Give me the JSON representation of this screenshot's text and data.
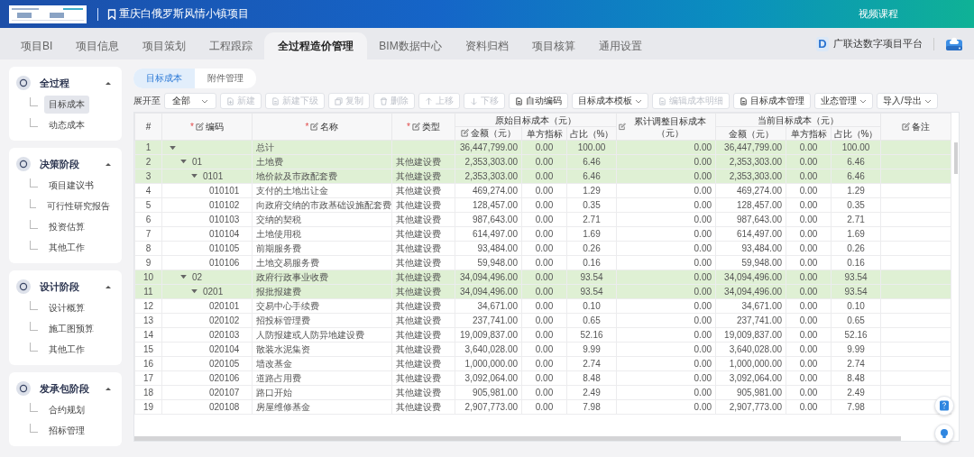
{
  "header": {
    "project_title": "重庆白俄罗斯风情小镇项目",
    "video_course": "视频课程"
  },
  "nav_tabs": [
    {
      "label": "项目BI",
      "selected": false
    },
    {
      "label": "项目信息",
      "selected": false
    },
    {
      "label": "项目策划",
      "selected": false
    },
    {
      "label": "工程跟踪",
      "selected": false
    },
    {
      "label": "全过程造价管理",
      "selected": true
    },
    {
      "label": "BIM数据中心",
      "selected": false
    },
    {
      "label": "资料归档",
      "selected": false
    },
    {
      "label": "项目核算",
      "selected": false
    },
    {
      "label": "通用设置",
      "selected": false
    }
  ],
  "platform": {
    "logo_letter": "D",
    "name": "广联达数字项目平台"
  },
  "sidebar": {
    "groups": [
      {
        "title": "全过程",
        "expanded": true,
        "items": [
          {
            "label": "目标成本",
            "selected": true
          },
          {
            "label": "动态成本",
            "selected": false
          }
        ]
      },
      {
        "title": "决策阶段",
        "expanded": true,
        "items": [
          {
            "label": "项目建议书",
            "selected": false
          },
          {
            "label": "可行性研究报告",
            "selected": false
          },
          {
            "label": "投资估算",
            "selected": false
          },
          {
            "label": "其他工作",
            "selected": false
          }
        ]
      },
      {
        "title": "设计阶段",
        "expanded": true,
        "items": [
          {
            "label": "设计概算",
            "selected": false
          },
          {
            "label": "施工图预算",
            "selected": false
          },
          {
            "label": "其他工作",
            "selected": false
          }
        ]
      },
      {
        "title": "发承包阶段",
        "expanded": true,
        "items": [
          {
            "label": "合约规划",
            "selected": false
          },
          {
            "label": "招标管理",
            "selected": false
          }
        ]
      }
    ]
  },
  "subtabs": [
    {
      "label": "目标成本",
      "selected": true
    },
    {
      "label": "附件管理",
      "selected": false
    }
  ],
  "toolbar": {
    "expand_label": "展开至",
    "expand_value": "全部",
    "buttons": [
      {
        "label": "新建",
        "kind": "button",
        "disabled": true
      },
      {
        "label": "新建下级",
        "kind": "button",
        "disabled": true
      },
      {
        "label": "复制",
        "kind": "button",
        "disabled": true
      },
      {
        "label": "删除",
        "kind": "button",
        "disabled": true
      },
      {
        "label": "上移",
        "kind": "button",
        "disabled": true
      },
      {
        "label": "下移",
        "kind": "button",
        "disabled": true
      },
      {
        "label": "自动编码",
        "kind": "button",
        "disabled": false
      },
      {
        "label": "目标成本模板",
        "kind": "dropdown",
        "disabled": false
      },
      {
        "label": "编辑成本明细",
        "kind": "button",
        "disabled": true
      },
      {
        "label": "目标成本管理",
        "kind": "button",
        "disabled": false
      },
      {
        "label": "业态管理",
        "kind": "dropdown",
        "disabled": false
      },
      {
        "label": "导入/导出",
        "kind": "dropdown",
        "disabled": false
      }
    ]
  },
  "table": {
    "columns": [
      {
        "label": "#"
      },
      {
        "label": "编码",
        "required": true,
        "marker": "*",
        "editable": true
      },
      {
        "label": "名称",
        "required": true,
        "marker": "*",
        "editable": true
      },
      {
        "label": "类型",
        "required": true,
        "marker": "*",
        "editable": true
      },
      {
        "label": "金额（元）",
        "editable": true
      },
      {
        "label": "单方指标"
      },
      {
        "label": "占比（%）"
      },
      {
        "label": "累计调整目标成本（元）",
        "editable": true
      },
      {
        "label": "金额（元）"
      },
      {
        "label": "单方指标"
      },
      {
        "label": "占比（%）"
      },
      {
        "label": "备注",
        "editable": true
      }
    ],
    "column_groups": [
      {
        "label": "原始目标成本（元）"
      },
      {
        "label": "当前目标成本（元）"
      }
    ],
    "rows": [
      {
        "cells": [
          "1",
          "",
          "总计",
          "",
          "36,447,799.00",
          "0.00",
          "100.00",
          "0.00",
          "36,447,799.00",
          "0.00",
          "100.00"
        ],
        "expanded": true,
        "children": [
          {
            "cells": [
              "2",
              "01",
              "土地费",
              "其他建设费",
              "2,353,303.00",
              "0.00",
              "6.46",
              "0.00",
              "2,353,303.00",
              "0.00",
              "6.46"
            ],
            "expanded": true,
            "children": [
              {
                "cells": [
                  "3",
                  "0101",
                  "地价款及市政配套费",
                  "其他建设费",
                  "2,353,303.00",
                  "0.00",
                  "6.46",
                  "0.00",
                  "2,353,303.00",
                  "0.00",
                  "6.46"
                ],
                "expanded": true,
                "children": [
                  {
                    "cells": [
                      "4",
                      "010101",
                      "支付的土地出让金",
                      "其他建设费",
                      "469,274.00",
                      "0.00",
                      "1.29",
                      "0.00",
                      "469,274.00",
                      "0.00",
                      "1.29"
                    ]
                  },
                  {
                    "cells": [
                      "5",
                      "010102",
                      "向政府交纳的市政基础设施配套费",
                      "其他建设费",
                      "128,457.00",
                      "0.00",
                      "0.35",
                      "0.00",
                      "128,457.00",
                      "0.00",
                      "0.35"
                    ]
                  },
                  {
                    "cells": [
                      "6",
                      "010103",
                      "交纳的契税",
                      "其他建设费",
                      "987,643.00",
                      "0.00",
                      "2.71",
                      "0.00",
                      "987,643.00",
                      "0.00",
                      "2.71"
                    ]
                  },
                  {
                    "cells": [
                      "7",
                      "010104",
                      "土地使用税",
                      "其他建设费",
                      "614,497.00",
                      "0.00",
                      "1.69",
                      "0.00",
                      "614,497.00",
                      "0.00",
                      "1.69"
                    ]
                  },
                  {
                    "cells": [
                      "8",
                      "010105",
                      "前期服务费",
                      "其他建设费",
                      "93,484.00",
                      "0.00",
                      "0.26",
                      "0.00",
                      "93,484.00",
                      "0.00",
                      "0.26"
                    ]
                  },
                  {
                    "cells": [
                      "9",
                      "010106",
                      "土地交易服务费",
                      "其他建设费",
                      "59,948.00",
                      "0.00",
                      "0.16",
                      "0.00",
                      "59,948.00",
                      "0.00",
                      "0.16"
                    ]
                  }
                ]
              }
            ]
          },
          {
            "cells": [
              "10",
              "02",
              "政府行政事业收费",
              "其他建设费",
              "34,094,496.00",
              "0.00",
              "93.54",
              "0.00",
              "34,094,496.00",
              "0.00",
              "93.54"
            ],
            "expanded": true,
            "children": [
              {
                "cells": [
                  "11",
                  "0201",
                  "报批报建费",
                  "其他建设费",
                  "34,094,496.00",
                  "0.00",
                  "93.54",
                  "0.00",
                  "34,094,496.00",
                  "0.00",
                  "93.54"
                ],
                "expanded": true,
                "children": [
                  {
                    "cells": [
                      "12",
                      "020101",
                      "交易中心手续费",
                      "其他建设费",
                      "34,671.00",
                      "0.00",
                      "0.10",
                      "0.00",
                      "34,671.00",
                      "0.00",
                      "0.10"
                    ]
                  },
                  {
                    "cells": [
                      "13",
                      "020102",
                      "招投标管理费",
                      "其他建设费",
                      "237,741.00",
                      "0.00",
                      "0.65",
                      "0.00",
                      "237,741.00",
                      "0.00",
                      "0.65"
                    ]
                  },
                  {
                    "cells": [
                      "14",
                      "020103",
                      "人防报建或人防异地建设费",
                      "其他建设费",
                      "19,009,837.00",
                      "0.00",
                      "52.16",
                      "0.00",
                      "19,009,837.00",
                      "0.00",
                      "52.16"
                    ]
                  },
                  {
                    "cells": [
                      "15",
                      "020104",
                      "散装水泥集资",
                      "其他建设费",
                      "3,640,028.00",
                      "0.00",
                      "9.99",
                      "0.00",
                      "3,640,028.00",
                      "0.00",
                      "9.99"
                    ]
                  },
                  {
                    "cells": [
                      "16",
                      "020105",
                      "墙改基金",
                      "其他建设费",
                      "1,000,000.00",
                      "0.00",
                      "2.74",
                      "0.00",
                      "1,000,000.00",
                      "0.00",
                      "2.74"
                    ]
                  },
                  {
                    "cells": [
                      "17",
                      "020106",
                      "道路占用费",
                      "其他建设费",
                      "3,092,064.00",
                      "0.00",
                      "8.48",
                      "0.00",
                      "3,092,064.00",
                      "0.00",
                      "8.48"
                    ]
                  },
                  {
                    "cells": [
                      "18",
                      "020107",
                      "路口开始",
                      "其他建设费",
                      "905,981.00",
                      "0.00",
                      "2.49",
                      "0.00",
                      "905,981.00",
                      "0.00",
                      "2.49"
                    ]
                  },
                  {
                    "cells": [
                      "19",
                      "020108",
                      "房屋维修基金",
                      "其他建设费",
                      "2,907,773.00",
                      "0.00",
                      "7.98",
                      "0.00",
                      "2,907,773.00",
                      "0.00",
                      "7.98"
                    ]
                  }
                ]
              }
            ]
          }
        ]
      }
    ]
  }
}
